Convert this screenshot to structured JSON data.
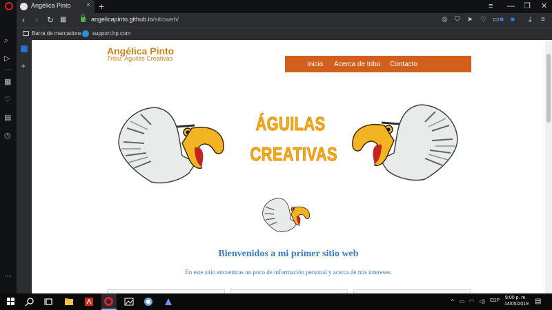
{
  "browser": {
    "tab_title": "Angélica Pinto",
    "tab_close": "×",
    "new_tab": "+",
    "url_host": "angelicapinto.github.io",
    "url_path": "/sitioweb/",
    "nav_back": "‹",
    "nav_forward": "›",
    "nav_reload": "↻",
    "nav_speeddial": "▦",
    "window_minimize": "—",
    "window_restore": "❐",
    "window_close": "✕",
    "window_menu": "≡",
    "bookmarks": [
      {
        "label": "Barra de marcadore..."
      },
      {
        "label": "support.hp.com"
      }
    ],
    "sidebar_more": "···",
    "panel_plus": "+"
  },
  "site": {
    "title": "Angélica Pinto",
    "subtitle": "Tribu: Águilas Creativas",
    "nav": [
      "Inicio",
      "Acerca de tribu",
      "Contacto"
    ],
    "banner_line1": "ÁGUILAS",
    "banner_line2": "CREATIVAS",
    "welcome_heading": "Bienvenidos a mi primer sitio web",
    "welcome_text": "En este sitio encuentras un poco de información personal y acerca de mis intereses."
  },
  "colors": {
    "accent_orange": "#d35f1c",
    "title_gold": "#c7841a",
    "link_blue": "#3a7bc0",
    "banner_yellow": "#f5a91d"
  },
  "taskbar": {
    "language": "ESP",
    "time": "9:00 p. m.",
    "date": "14/05/2019"
  }
}
